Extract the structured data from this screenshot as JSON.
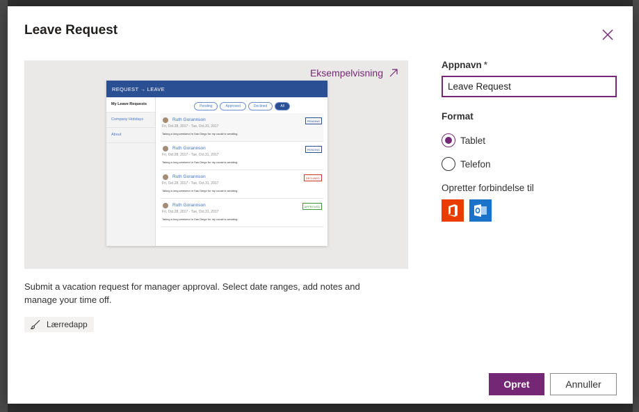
{
  "dialog": {
    "title": "Leave Request",
    "close_icon": "close-icon"
  },
  "preview": {
    "link_label": "Eksempelvisning",
    "link_icon": "open-external-icon",
    "mock": {
      "header": "REQUEST → LEAVE",
      "sidebar": [
        "My Leave Requests",
        "Company Holidays",
        "About"
      ],
      "tabs": [
        "Pending",
        "Approved",
        "Declined",
        "All"
      ],
      "items": [
        {
          "name": "Ruth Gorannson",
          "dates": "Fri, Oct.28, 2017 - Tue, Oct.31, 2017",
          "desc": "Taking a long weekend in San Diego for my cousin's wedding.",
          "status": "PENDING"
        },
        {
          "name": "Ruth Gorannson",
          "dates": "Fri, Oct.28, 2017 - Tue, Oct.31, 2017",
          "desc": "Taking a long weekend in San Diego for my cousin's wedding.",
          "status": "PENDING"
        },
        {
          "name": "Ruth Gorannson",
          "dates": "Fri, Oct.28, 2017 - Tue, Oct.31, 2017",
          "desc": "Taking a long weekend in San Diego for my cousin's wedding.",
          "status": "DECLINED"
        },
        {
          "name": "Ruth Gorannson",
          "dates": "Fri, Oct.28, 2017 - Tue, Oct.31, 2017",
          "desc": "Taking a long weekend in San Diego for my cousin's wedding.",
          "status": "APPROVED"
        }
      ]
    }
  },
  "description": "Submit a vacation request for manager approval. Select date ranges, add notes and manage your time off.",
  "tag": {
    "label": "Lærredapp",
    "icon": "brush-icon"
  },
  "form": {
    "appname_label": "Appnavn",
    "required_mark": "*",
    "appname_value": "Leave Request",
    "format_label": "Format",
    "format_options": [
      {
        "label": "Tablet",
        "selected": true
      },
      {
        "label": "Telefon",
        "selected": false
      }
    ],
    "connects_label": "Opretter forbindelse til",
    "connectors": [
      {
        "icon": "office365-icon",
        "color": "#eb3c00"
      },
      {
        "icon": "outlook-icon",
        "color": "#1a73c8"
      }
    ]
  },
  "buttons": {
    "create": "Opret",
    "cancel": "Annuller"
  },
  "colors": {
    "accent": "#742774",
    "preview_bg": "#ebe9e8"
  }
}
